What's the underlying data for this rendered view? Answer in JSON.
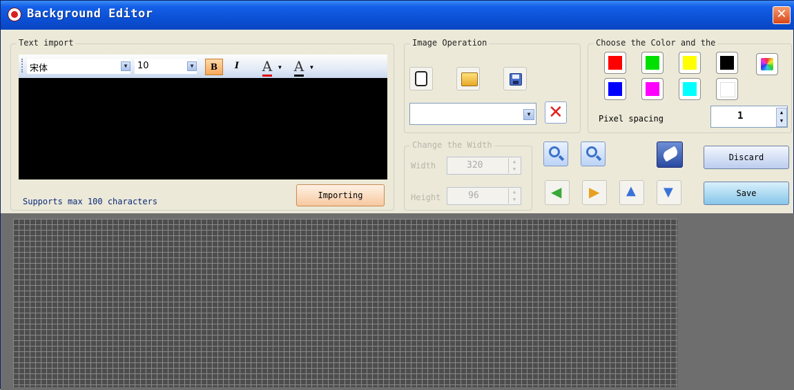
{
  "window": {
    "title": "Background Editor"
  },
  "text_import": {
    "legend": "Text import",
    "font_name": "宋体",
    "font_size": "10",
    "bold_label": "B",
    "italic_label": "I",
    "font_color_label": "A",
    "highlight_label": "A",
    "hint": "Supports max 100 characters",
    "import_button": "Importing"
  },
  "image_operation": {
    "legend": "Image Operation",
    "file_select_value": ""
  },
  "size_change": {
    "legend": "Change the Width",
    "width_label": "Width",
    "width_value": "320",
    "height_label": "Height",
    "height_value": "96"
  },
  "color_choice": {
    "legend": "Choose the Color and the",
    "colors": [
      "#ff0000",
      "#00e000",
      "#ffff00",
      "#000000",
      "#0000ff",
      "#ff00ff",
      "#00ffff",
      "#ffffff"
    ],
    "pixel_spacing_label": "Pixel spacing",
    "pixel_spacing_value": "1"
  },
  "actions": {
    "discard": "Discard",
    "save": "Save"
  },
  "icons": {
    "new": "new-file-icon",
    "open": "open-folder-icon",
    "save": "save-disk-icon",
    "delete": "red-x-icon",
    "zoom_out": "zoom-out-icon",
    "zoom_in": "zoom-in-icon",
    "paint": "paint-brush-icon",
    "left": "arrow-left-icon",
    "right": "arrow-right-icon",
    "up": "arrow-up-icon",
    "down": "arrow-down-icon",
    "palette": "color-palette-icon"
  }
}
